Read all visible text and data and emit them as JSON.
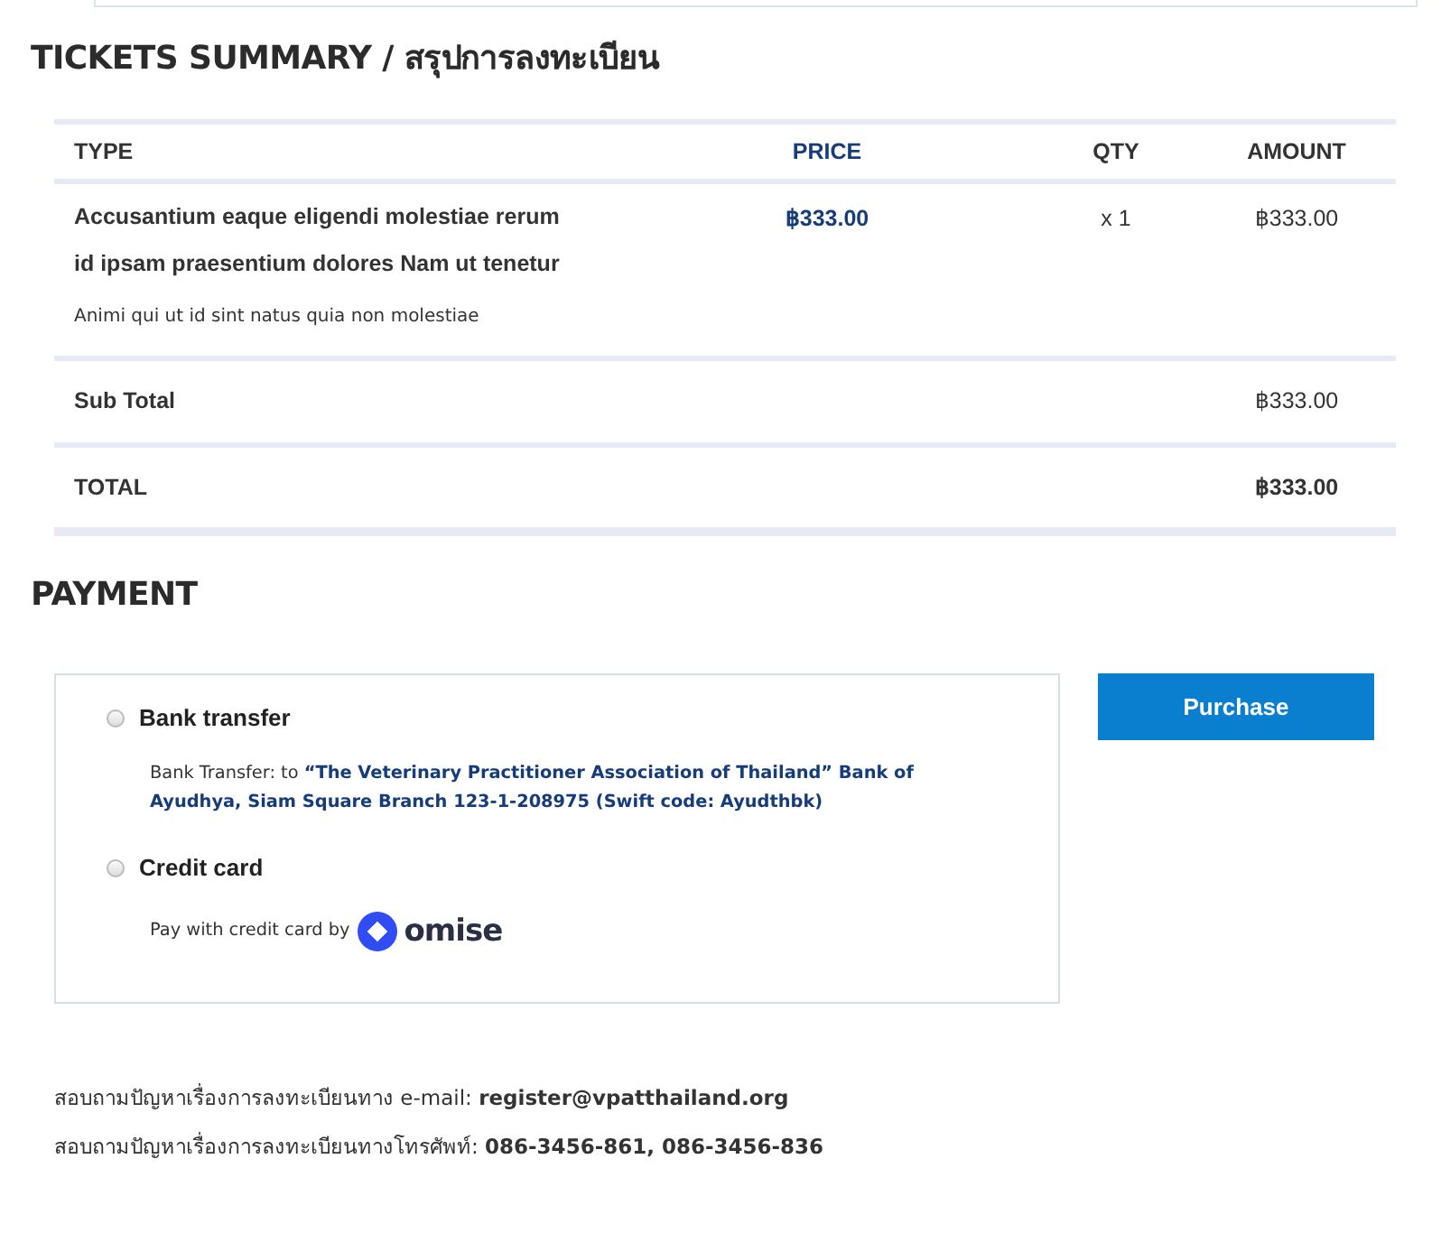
{
  "title": "TICKETS SUMMARY / สรุปการลงทะเบียน",
  "table": {
    "columns": [
      "TYPE",
      "PRICE",
      "QTY",
      "AMOUNT"
    ],
    "rows": [
      {
        "kind": "item",
        "type_lines": [
          "Accusantium eaque eligendi molestiae rerum",
          "id ipsam praesentium dolores Nam ut tenetur"
        ],
        "description": "Animi qui ut id sint natus quia non molestiae",
        "price": "฿333.00",
        "qty": "x 1",
        "amount": "฿333.00"
      },
      {
        "kind": "subtotal",
        "label": "Sub Total",
        "amount": "฿333.00"
      },
      {
        "kind": "total",
        "label": "TOTAL",
        "amount": "฿333.00"
      }
    ]
  },
  "payment": {
    "title": "PAYMENT",
    "methods": [
      {
        "label": "Bank transfer",
        "selected": false,
        "kind": "bank",
        "detail": "Bank Transfer: to **“The Veterinary Practitioner Association of Thailand” Bank of Ayudhya, Siam Square Branch 123-1-208975 (Swift code: Ayudthbk)**"
      },
      {
        "label": "Credit card",
        "selected": false,
        "kind": "card",
        "detail": "Pay with credit card by",
        "brand": "omise"
      }
    ],
    "button": "Purchase"
  },
  "contacts": [
    {
      "label": "สอบถามปัญหาเรื่องการลงทะเบียนทาง e-mail:",
      "value": "register@vpatthailand.org"
    },
    {
      "label": "สอบถามปัญหาเรื่องการลงทะเบียนทางโทรศัพท์:",
      "value": "086-3456-861, 086-3456-836"
    }
  ]
}
